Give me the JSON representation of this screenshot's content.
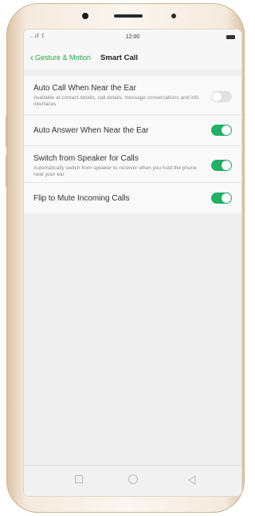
{
  "status_bar": {
    "signal": "..ıl ⟟",
    "time": "12:00"
  },
  "header": {
    "back_label": "Gesture & Motion",
    "title": "Smart Call"
  },
  "settings": [
    {
      "title": "Auto Call When Near the Ear",
      "subtitle": "Available at contact details, call details, message conversations and info interfaces",
      "enabled": false
    },
    {
      "title": "Auto Answer When Near the Ear",
      "subtitle": "",
      "enabled": true
    },
    {
      "title": "Switch from Speaker for Calls",
      "subtitle": "Automatically switch from speaker to receiver when you hold the phone near your ear",
      "enabled": true
    },
    {
      "title": "Flip to Mute Incoming Calls",
      "subtitle": "",
      "enabled": true
    }
  ],
  "colors": {
    "accent": "#2aa84a",
    "toggle_on": "#21b064",
    "toggle_off": "#e2e2e2"
  },
  "icons": {
    "back": "chevron-left-icon",
    "recent": "square-icon",
    "home": "circle-icon",
    "nav_back": "triangle-back-icon"
  }
}
